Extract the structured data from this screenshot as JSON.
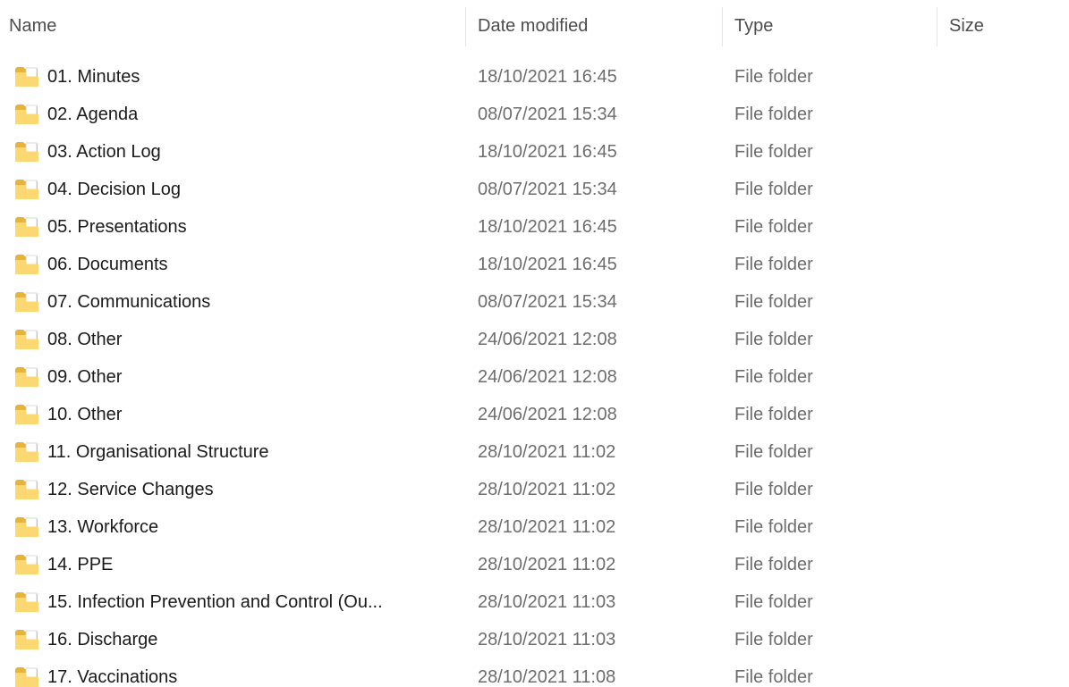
{
  "columns": {
    "name": "Name",
    "date_modified": "Date modified",
    "type": "Type",
    "size": "Size"
  },
  "colors": {
    "folder_back": "#e8b33a",
    "folder_front": "#fcd873",
    "folder_paper": "#ffffff"
  },
  "files": [
    {
      "name": "01. Minutes",
      "date": "18/10/2021 16:45",
      "type": "File folder",
      "size": "",
      "icon": "folder-icon"
    },
    {
      "name": "02. Agenda",
      "date": "08/07/2021 15:34",
      "type": "File folder",
      "size": "",
      "icon": "folder-icon"
    },
    {
      "name": "03. Action Log",
      "date": "18/10/2021 16:45",
      "type": "File folder",
      "size": "",
      "icon": "folder-icon"
    },
    {
      "name": "04. Decision Log",
      "date": "08/07/2021 15:34",
      "type": "File folder",
      "size": "",
      "icon": "folder-icon"
    },
    {
      "name": "05. Presentations",
      "date": "18/10/2021 16:45",
      "type": "File folder",
      "size": "",
      "icon": "folder-icon"
    },
    {
      "name": "06. Documents",
      "date": "18/10/2021 16:45",
      "type": "File folder",
      "size": "",
      "icon": "folder-icon"
    },
    {
      "name": "07. Communications",
      "date": "08/07/2021 15:34",
      "type": "File folder",
      "size": "",
      "icon": "folder-icon"
    },
    {
      "name": "08. Other",
      "date": "24/06/2021 12:08",
      "type": "File folder",
      "size": "",
      "icon": "folder-icon"
    },
    {
      "name": "09. Other",
      "date": "24/06/2021 12:08",
      "type": "File folder",
      "size": "",
      "icon": "folder-icon"
    },
    {
      "name": "10. Other",
      "date": "24/06/2021 12:08",
      "type": "File folder",
      "size": "",
      "icon": "folder-icon"
    },
    {
      "name": "11. Organisational Structure",
      "date": "28/10/2021 11:02",
      "type": "File folder",
      "size": "",
      "icon": "folder-icon"
    },
    {
      "name": "12. Service Changes",
      "date": "28/10/2021 11:02",
      "type": "File folder",
      "size": "",
      "icon": "folder-icon"
    },
    {
      "name": "13. Workforce",
      "date": "28/10/2021 11:02",
      "type": "File folder",
      "size": "",
      "icon": "folder-icon"
    },
    {
      "name": "14. PPE",
      "date": "28/10/2021 11:02",
      "type": "File folder",
      "size": "",
      "icon": "folder-icon"
    },
    {
      "name": "15. Infection Prevention and Control (Ou...",
      "date": "28/10/2021 11:03",
      "type": "File folder",
      "size": "",
      "icon": "folder-icon"
    },
    {
      "name": "16. Discharge",
      "date": "28/10/2021 11:03",
      "type": "File folder",
      "size": "",
      "icon": "folder-icon"
    },
    {
      "name": "17. Vaccinations",
      "date": "28/10/2021 11:08",
      "type": "File folder",
      "size": "",
      "icon": "folder-icon"
    }
  ]
}
